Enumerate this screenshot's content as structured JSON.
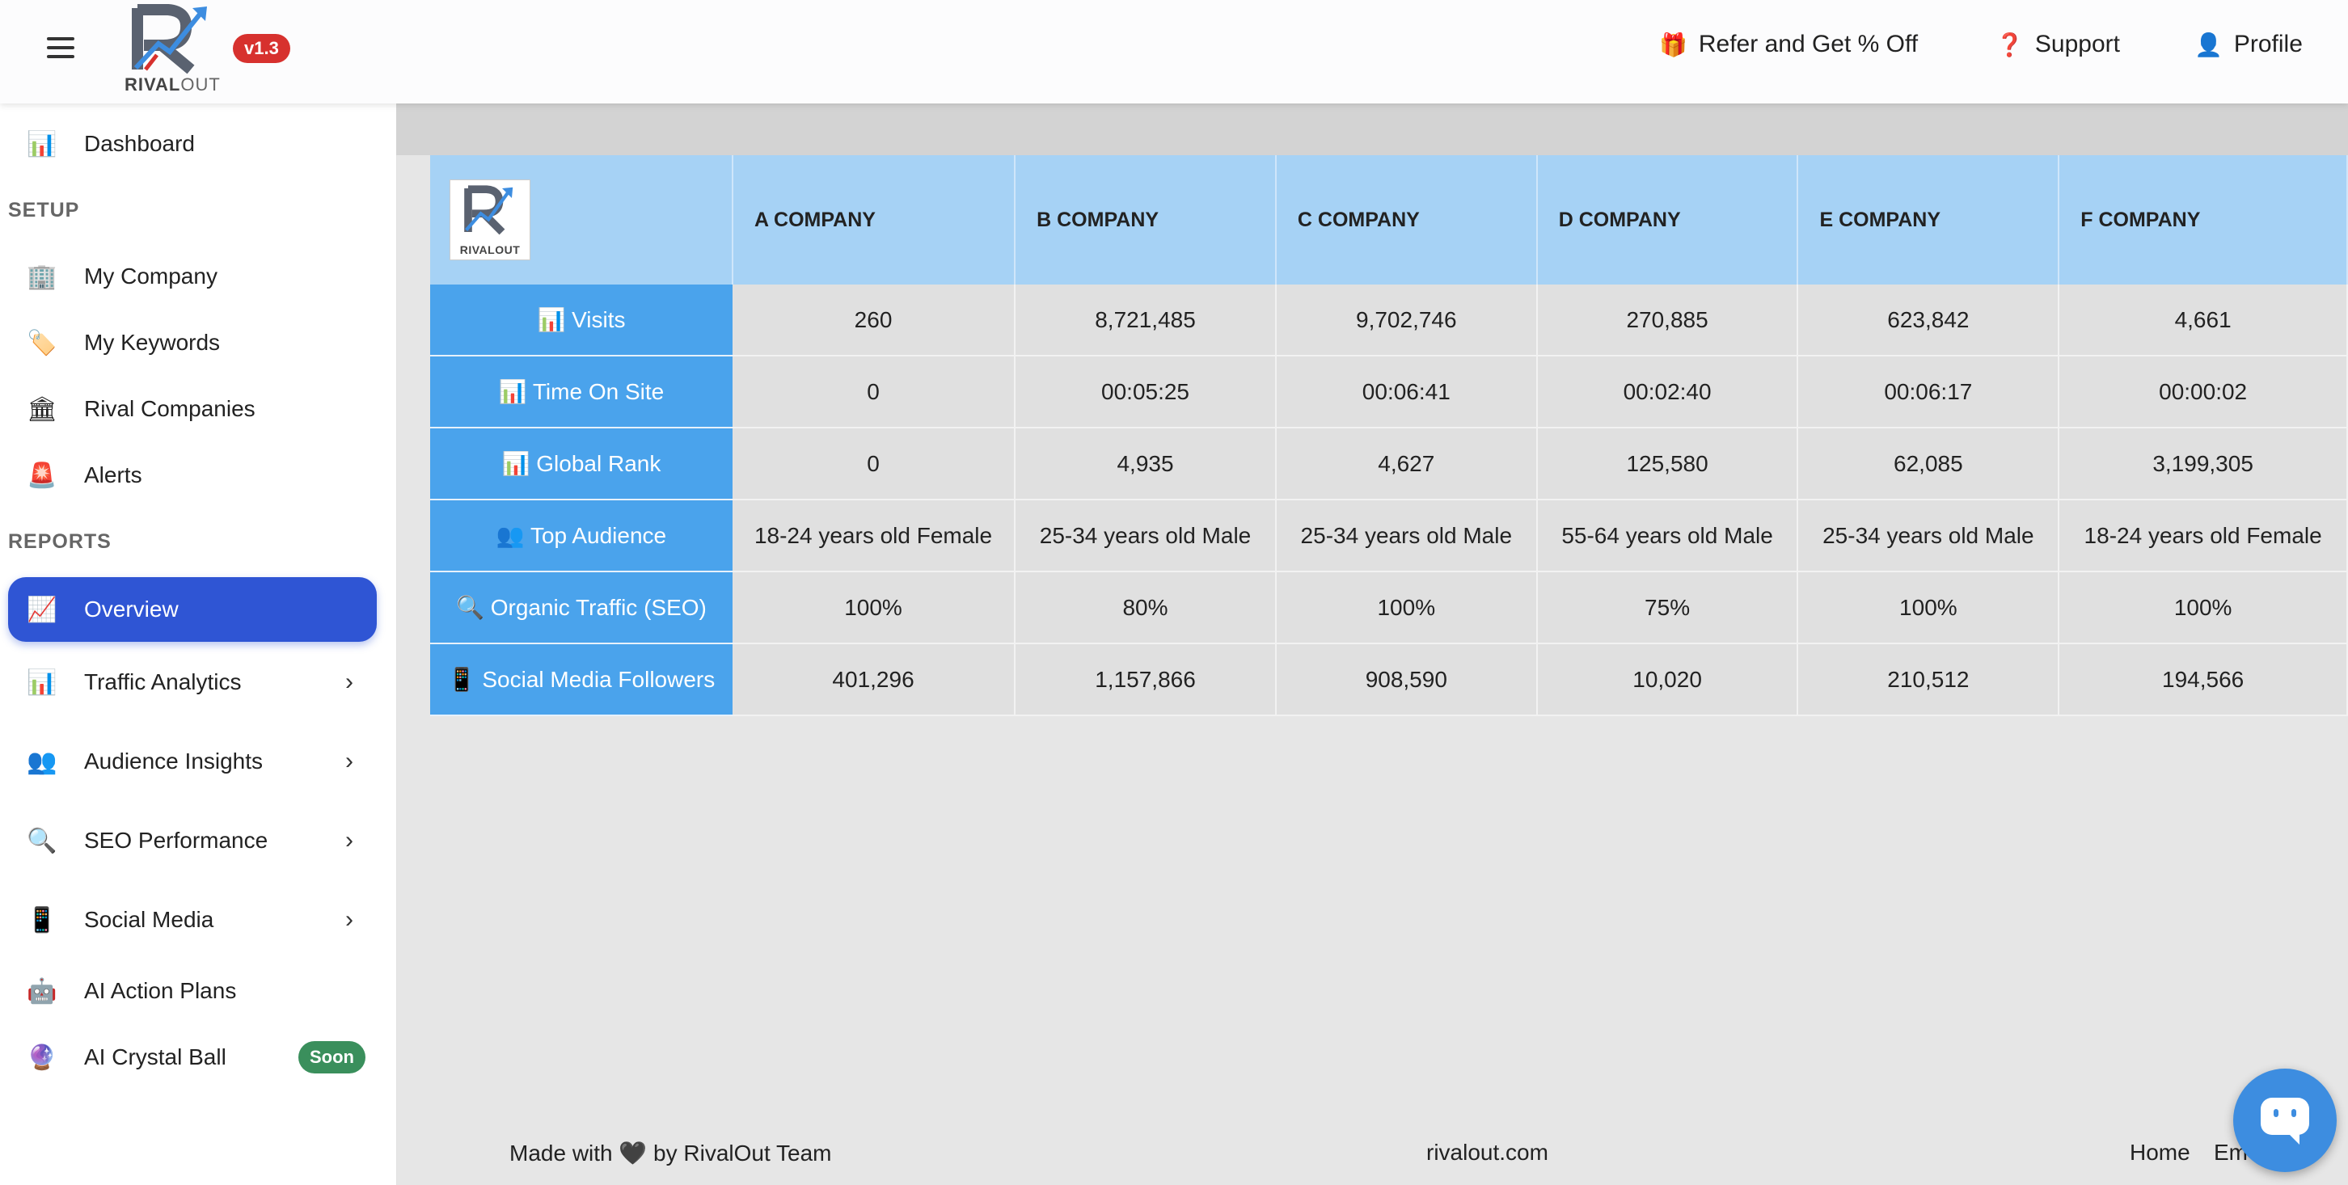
{
  "header": {
    "version": "v1.3",
    "logo_text_rival": "RIVAL",
    "logo_text_out": "OUT",
    "refer": {
      "icon": "gift-icon",
      "glyph": "🎁",
      "label": "Refer and Get % Off"
    },
    "support": {
      "icon": "question-icon",
      "glyph": "❓",
      "label": "Support"
    },
    "profile": {
      "icon": "user-icon",
      "glyph": "👤",
      "label": "Profile"
    }
  },
  "sidebar": {
    "dashboard": {
      "glyph": "📊",
      "label": "Dashboard"
    },
    "setup_title": "SETUP",
    "my_company": {
      "glyph": "🏢",
      "label": "My Company"
    },
    "my_keywords": {
      "glyph": "🏷️",
      "label": "My Keywords"
    },
    "rival_companies": {
      "glyph": "🏛",
      "label": "Rival Companies"
    },
    "alerts": {
      "glyph": "🚨",
      "label": "Alerts"
    },
    "reports_title": "REPORTS",
    "overview": {
      "glyph": "📈",
      "label": "Overview"
    },
    "traffic_analytics": {
      "glyph": "📊",
      "label": "Traffic Analytics",
      "chevron": "›"
    },
    "audience_insights": {
      "glyph": "👥",
      "label": "Audience Insights",
      "chevron": "›"
    },
    "seo_performance": {
      "glyph": "🔍",
      "label": "SEO Performance",
      "chevron": "›"
    },
    "social_media": {
      "glyph": "📱",
      "label": "Social Media",
      "chevron": "›"
    },
    "ai_action_plans": {
      "glyph": "🤖",
      "label": "AI Action Plans"
    },
    "ai_crystal_ball": {
      "glyph": "🔮",
      "label": "AI Crystal Ball",
      "badge": "Soon"
    }
  },
  "table": {
    "corner_logo_text": "RIVALOUT",
    "columns": [
      "A COMPANY",
      "B COMPANY",
      "C COMPANY",
      "D COMPANY",
      "E COMPANY",
      "F COMPANY"
    ],
    "rows": [
      {
        "metric": "📊 Visits",
        "values": [
          "260",
          "8,721,485",
          "9,702,746",
          "270,885",
          "623,842",
          "4,661"
        ]
      },
      {
        "metric": "📊 Time On Site",
        "values": [
          "0",
          "00:05:25",
          "00:06:41",
          "00:02:40",
          "00:06:17",
          "00:00:02"
        ]
      },
      {
        "metric": "📊 Global Rank",
        "values": [
          "0",
          "4,935",
          "4,627",
          "125,580",
          "62,085",
          "3,199,305"
        ]
      },
      {
        "metric": "👥 Top Audience",
        "values": [
          "18-24 years old Female",
          "25-34 years old Male",
          "25-34 years old Male",
          "55-64 years old Male",
          "25-34 years old Male",
          "18-24 years old Female"
        ]
      },
      {
        "metric": "🔍 Organic Traffic (SEO)",
        "values": [
          "100%",
          "80%",
          "100%",
          "75%",
          "100%",
          "100%"
        ]
      },
      {
        "metric": "📱 Social Media Followers",
        "values": [
          "401,296",
          "1,157,866",
          "908,590",
          "10,020",
          "210,512",
          "194,566"
        ]
      }
    ]
  },
  "footer": {
    "made_with": "Made with 🖤 by RivalOut Team",
    "site": "rivalout.com",
    "home": "Home",
    "email": "Em"
  },
  "colors": {
    "accent": "#2f55d4",
    "metric_cell": "#4aa3ec",
    "header_cell": "#a6d2f5",
    "version_badge": "#d7312e",
    "soon_badge": "#3a8f5c"
  }
}
